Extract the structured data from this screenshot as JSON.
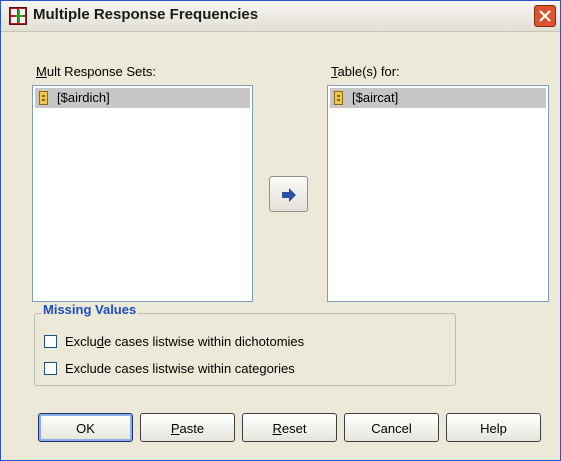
{
  "window": {
    "title": "Multiple Response Frequencies"
  },
  "source": {
    "label_mnemonic": "M",
    "label_rest": "ult Response Sets:",
    "items": [
      {
        "label": "[$airdich]"
      }
    ]
  },
  "target": {
    "label_mnemonic": "T",
    "label_rest": "able(s) for:",
    "items": [
      {
        "label": "[$aircat]"
      }
    ]
  },
  "missing_values": {
    "title": "Missing Values",
    "option1": {
      "pre": "Exclu",
      "mn": "d",
      "post": "e cases listwise within dichotomies",
      "checked": false
    },
    "option2": {
      "pre": "Exclude cases listwise within cate",
      "mn": "g",
      "post": "ories",
      "checked": false
    }
  },
  "buttons": {
    "ok": "OK",
    "paste_mn": "P",
    "paste_rest": "aste",
    "reset_mn": "R",
    "reset_rest": "eset",
    "cancel": "Cancel",
    "help": "Help"
  },
  "icons": {
    "title": "dialog-app-icon",
    "close": "close-icon",
    "variable": "multiple-response-set-icon",
    "move": "arrow-right-icon"
  },
  "colors": {
    "accent": "#1d4fbf",
    "close": "#d9542f",
    "selection": "#c7c7c7"
  }
}
